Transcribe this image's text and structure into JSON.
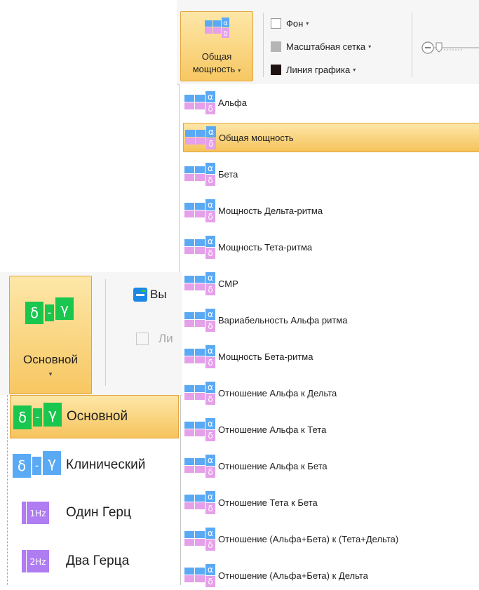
{
  "power_ribbon": {
    "button_label_line1": "Общая",
    "button_label_line2": "мощность",
    "background_label": "Фон",
    "scale_grid_label": "Масштабная сетка",
    "graph_line_label": "Линия графика"
  },
  "power_menu": {
    "items": [
      {
        "label": "Альфа"
      },
      {
        "label": "Общая мощность",
        "selected": true
      },
      {
        "label": "Бета"
      },
      {
        "label": "Мощность Дельта-ритма"
      },
      {
        "label": "Мощность Тета-ритма"
      },
      {
        "label": "СМР"
      },
      {
        "label": "Вариабельность Альфа ритма"
      },
      {
        "label": "Мощность Бета-ритма"
      },
      {
        "label": "Отношение Альфа к Дельта"
      },
      {
        "label": "Отношение Альфа к Тета"
      },
      {
        "label": "Отношение Альфа к Бета"
      },
      {
        "label": "Отношение Тета к Бета"
      },
      {
        "label": "Отношение (Альфа+Бета) к (Тета+Дельта)"
      },
      {
        "label": "Отношение (Альфа+Бета) к Дельта"
      }
    ]
  },
  "mode_ribbon": {
    "button_label": "Основной",
    "row1_partial": "Вы",
    "row2_partial": "Ли"
  },
  "mode_menu": {
    "items": [
      {
        "label": "Основной",
        "icon": "delta-gamma-green-icon",
        "selected": true
      },
      {
        "label": "Клинический",
        "icon": "delta-gamma-blue-icon"
      },
      {
        "label": "Один Герц",
        "icon": "one-hertz-icon",
        "badge": "1Hz"
      },
      {
        "label": "Два Герца",
        "icon": "two-hertz-icon",
        "badge": "2Hz"
      }
    ]
  },
  "icon_glyphs": {
    "alpha": "α",
    "delta": "δ",
    "gamma": "γ",
    "dash": "-"
  },
  "colors": {
    "selection_gradient_top": "#fde7a8",
    "selection_gradient_bottom": "#f6c35c",
    "selection_border": "#e3a63f",
    "icon_blue": "#5aa9f5",
    "icon_pink": "#e5a0ea",
    "icon_green": "#19c64e",
    "icon_purple": "#b07cf2"
  }
}
